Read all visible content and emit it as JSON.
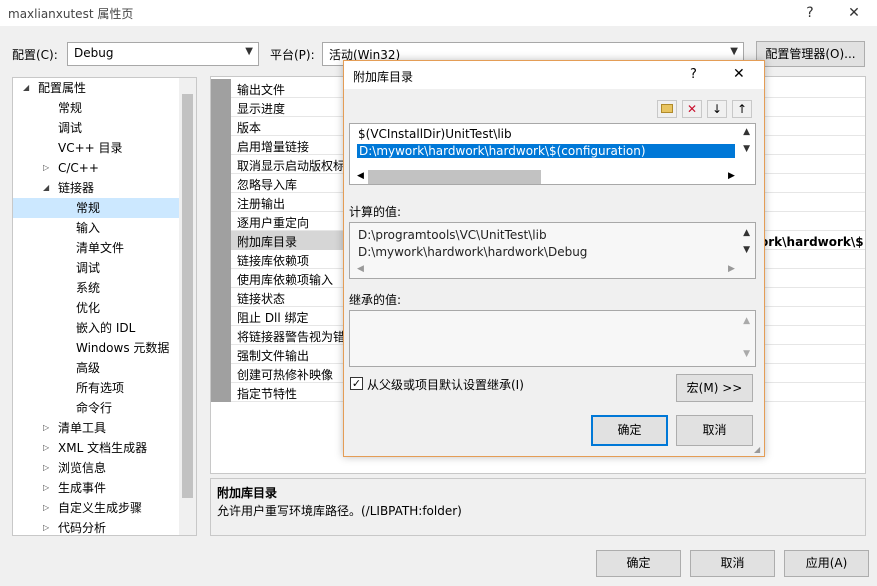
{
  "window": {
    "title": "maxlianxutest 属性页",
    "help_glyph": "?",
    "close_glyph": "✕"
  },
  "toolbar": {
    "config_label": "配置(C):",
    "config_value": "Debug",
    "platform_label": "平台(P):",
    "platform_value": "活动(Win32)",
    "config_manager_label": "配置管理器(O)..."
  },
  "tree": {
    "items": [
      {
        "label": "配置属性",
        "level": 0,
        "exp": "◢"
      },
      {
        "label": "常规",
        "level": 1,
        "exp": ""
      },
      {
        "label": "调试",
        "level": 1,
        "exp": ""
      },
      {
        "label": "VC++ 目录",
        "level": 1,
        "exp": ""
      },
      {
        "label": "C/C++",
        "level": 1,
        "exp": "▷"
      },
      {
        "label": "链接器",
        "level": 1,
        "exp": "◢"
      },
      {
        "label": "常规",
        "level": 2,
        "exp": "",
        "selected": true
      },
      {
        "label": "输入",
        "level": 2,
        "exp": ""
      },
      {
        "label": "清单文件",
        "level": 2,
        "exp": ""
      },
      {
        "label": "调试",
        "level": 2,
        "exp": ""
      },
      {
        "label": "系统",
        "level": 2,
        "exp": ""
      },
      {
        "label": "优化",
        "level": 2,
        "exp": ""
      },
      {
        "label": "嵌入的 IDL",
        "level": 2,
        "exp": ""
      },
      {
        "label": "Windows 元数据",
        "level": 2,
        "exp": ""
      },
      {
        "label": "高级",
        "level": 2,
        "exp": ""
      },
      {
        "label": "所有选项",
        "level": 2,
        "exp": ""
      },
      {
        "label": "命令行",
        "level": 2,
        "exp": ""
      },
      {
        "label": "清单工具",
        "level": 1,
        "exp": "▷"
      },
      {
        "label": "XML 文档生成器",
        "level": 1,
        "exp": "▷"
      },
      {
        "label": "浏览信息",
        "level": 1,
        "exp": "▷"
      },
      {
        "label": "生成事件",
        "level": 1,
        "exp": "▷"
      },
      {
        "label": "自定义生成步骤",
        "level": 1,
        "exp": "▷"
      },
      {
        "label": "代码分析",
        "level": 1,
        "exp": "▷"
      }
    ]
  },
  "grid": {
    "rows": [
      {
        "name": "输出文件"
      },
      {
        "name": "显示进度"
      },
      {
        "name": "版本"
      },
      {
        "name": "启用增量链接"
      },
      {
        "name": "取消显示启动版权标"
      },
      {
        "name": "忽略导入库"
      },
      {
        "name": "注册输出"
      },
      {
        "name": "逐用户重定向"
      },
      {
        "name": "附加库目录",
        "selected": true
      },
      {
        "name": "链接库依赖项"
      },
      {
        "name": "使用库依赖项输入"
      },
      {
        "name": "链接状态"
      },
      {
        "name": "阻止 Dll 绑定"
      },
      {
        "name": "将链接器警告视为错"
      },
      {
        "name": "强制文件输出"
      },
      {
        "name": "创建可热修补映像"
      },
      {
        "name": "指定节特性"
      }
    ],
    "selected_value_visible": "ork\\hardwork\\$"
  },
  "description": {
    "title": "附加库目录",
    "text": "允许用户重写环境库路径。(/LIBPATH:folder)"
  },
  "bottom_buttons": {
    "ok": "确定",
    "cancel": "取消",
    "apply": "应用(A)"
  },
  "modal": {
    "title": "附加库目录",
    "help_glyph": "?",
    "close_glyph": "✕",
    "tools": {
      "new_folder_icon": "new-folder-icon",
      "delete_glyph": "✕",
      "down_glyph": "↓",
      "up_glyph": "↑"
    },
    "entries": [
      "$(VCInstallDir)UnitTest\\lib",
      "D:\\mywork\\hardwork\\hardwork\\$(configuration)"
    ],
    "computed_label": "计算的值:",
    "computed": [
      "D:\\programtools\\VC\\UnitTest\\lib",
      "D:\\mywork\\hardwork\\hardwork\\Debug"
    ],
    "inherited_label": "继承的值:",
    "inherit_checkbox_label": "从父级或项目默认设置继承(I)",
    "inherit_checked": true,
    "checkmark": "✓",
    "macro_button": "宏(M) >>",
    "ok": "确定",
    "cancel": "取消"
  },
  "colors": {
    "accent": "#0078d7",
    "modal_border": "#e49d56",
    "selection": "#cce8ff"
  }
}
